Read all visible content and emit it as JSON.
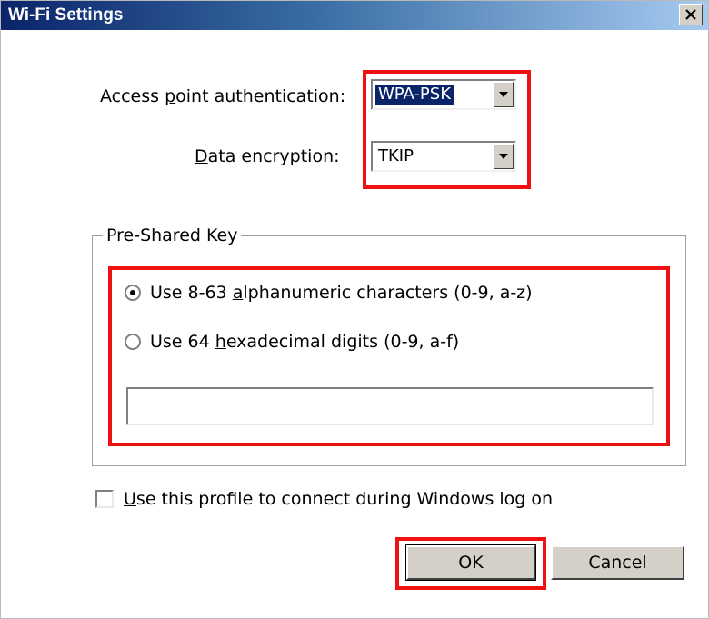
{
  "dialog": {
    "title": "Wi-Fi Settings",
    "close_glyph": "✕"
  },
  "auth": {
    "label_pre": "Access ",
    "label_u": "p",
    "label_post": "oint authentication:",
    "value": "WPA-PSK"
  },
  "encryption": {
    "label_pre": "",
    "label_u": "D",
    "label_post": "ata encryption:",
    "value": "TKIP"
  },
  "psk": {
    "group_label": "Pre-Shared Key",
    "option1_pre": "Use 8-63 ",
    "option1_u": "a",
    "option1_post": "lphanumeric characters (0-9, a-z)",
    "option2_pre": "Use 64 ",
    "option2_u": "h",
    "option2_post": "exadecimal digits (0-9, a-f)",
    "selected_option": 1,
    "key_value": ""
  },
  "logon": {
    "label_u": "U",
    "label_post": "se this profile to connect during Windows log on",
    "checked": false
  },
  "buttons": {
    "ok": "OK",
    "cancel": "Cancel"
  },
  "colors": {
    "highlight_border": "#ee1111",
    "title_gradient_start": "#0a246a",
    "title_gradient_end": "#a6caf0"
  }
}
